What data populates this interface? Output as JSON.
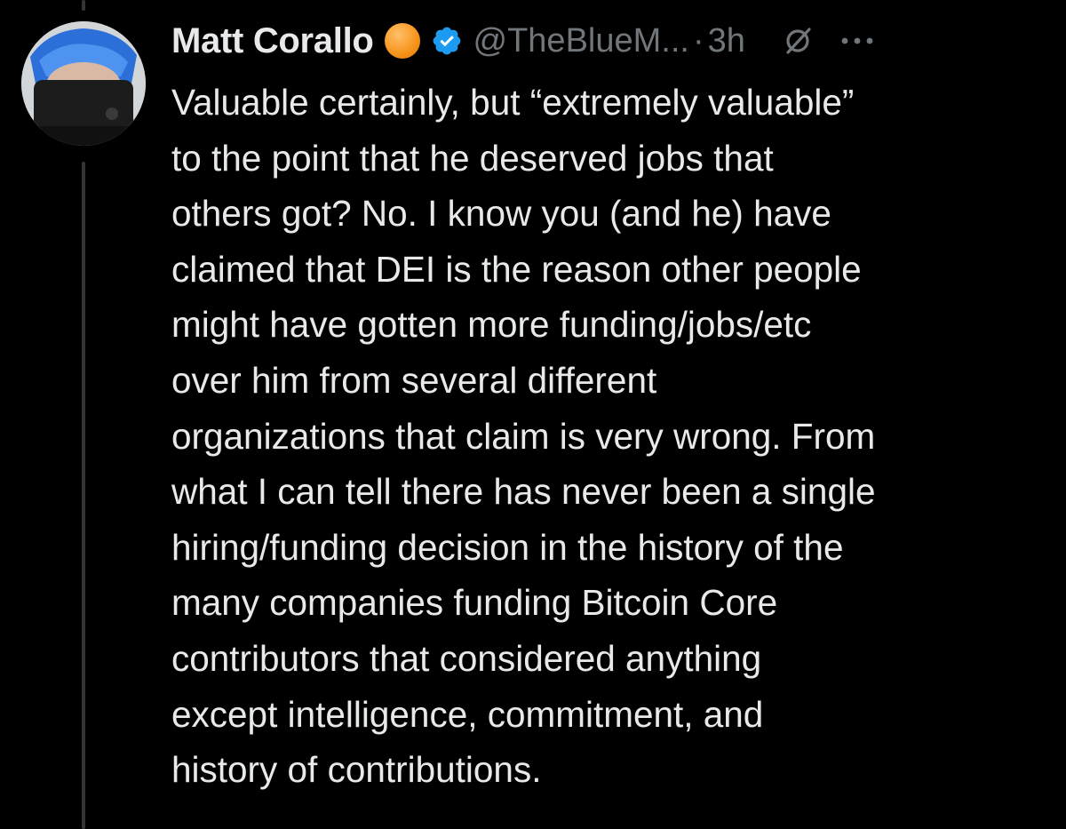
{
  "author": {
    "name": "Matt Corallo",
    "handle": "@TheBlueM...",
    "separator": "·",
    "time": "3h"
  },
  "icons": {
    "badge": "orange-circle-emoji",
    "verified": "verified-badge-icon",
    "grok": "grok-icon",
    "more": "more-horizontal-icon"
  },
  "colors": {
    "background": "#000000",
    "text": "#e7e9ea",
    "secondary": "#71767b",
    "verified": "#1d9bf0",
    "badge": "#f7931a"
  },
  "tweet": {
    "lines": [
      "Valuable certainly, but “extremely valuable”",
      "to the point that he deserved jobs that",
      "others got? No. I know you (and he) have",
      "claimed that DEI is the reason other people",
      "might have gotten more funding/jobs/etc",
      "over him from several different",
      "organizations that claim is very wrong. From",
      "what I can tell there has never been a single",
      "hiring/funding decision in the history of the",
      "many companies funding Bitcoin Core",
      "contributors that considered anything",
      "except intelligence, commitment, and",
      "history of contributions."
    ]
  }
}
